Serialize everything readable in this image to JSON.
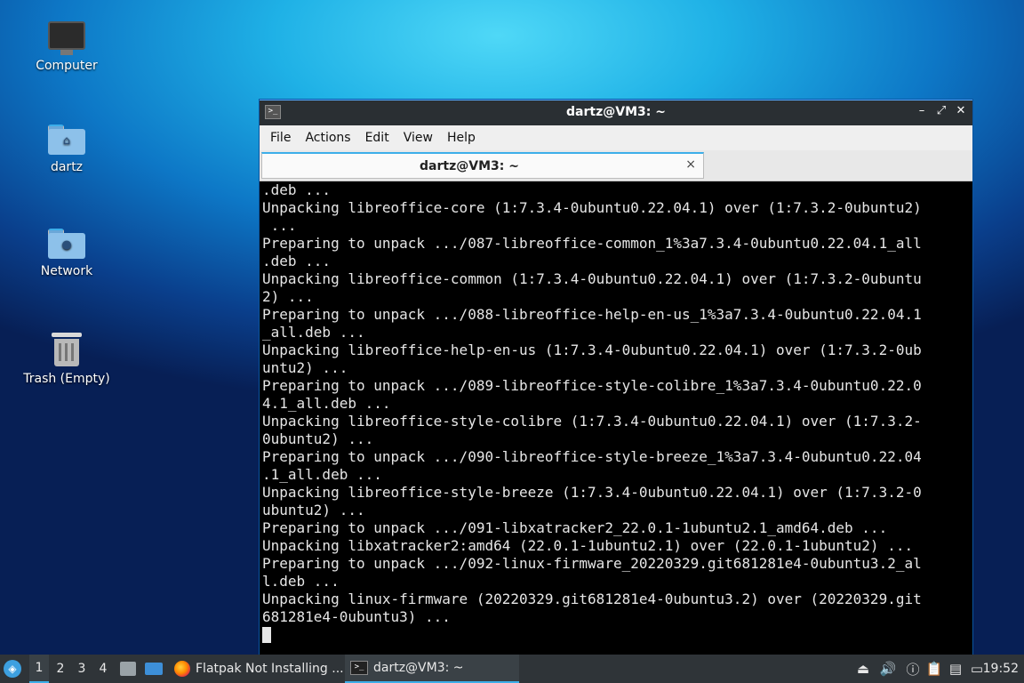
{
  "desktop": {
    "icons": [
      {
        "label": "Computer"
      },
      {
        "label": "dartz"
      },
      {
        "label": "Network"
      },
      {
        "label": "Trash (Empty)"
      }
    ]
  },
  "window": {
    "title": "dartz@VM3: ~",
    "menu": [
      "File",
      "Actions",
      "Edit",
      "View",
      "Help"
    ],
    "tab_label": "dartz@VM3: ~",
    "tab_close": "×",
    "buttons": {
      "minimize": "–",
      "maximize": "⤢",
      "close": "✕"
    }
  },
  "terminal": {
    "lines": [
      ".deb ...",
      "Unpacking libreoffice-core (1:7.3.4-0ubuntu0.22.04.1) over (1:7.3.2-0ubuntu2)",
      " ...",
      "Preparing to unpack .../087-libreoffice-common_1%3a7.3.4-0ubuntu0.22.04.1_all",
      ".deb ...",
      "Unpacking libreoffice-common (1:7.3.4-0ubuntu0.22.04.1) over (1:7.3.2-0ubuntu",
      "2) ...",
      "Preparing to unpack .../088-libreoffice-help-en-us_1%3a7.3.4-0ubuntu0.22.04.1",
      "_all.deb ...",
      "Unpacking libreoffice-help-en-us (1:7.3.4-0ubuntu0.22.04.1) over (1:7.3.2-0ub",
      "untu2) ...",
      "Preparing to unpack .../089-libreoffice-style-colibre_1%3a7.3.4-0ubuntu0.22.0",
      "4.1_all.deb ...",
      "Unpacking libreoffice-style-colibre (1:7.3.4-0ubuntu0.22.04.1) over (1:7.3.2-",
      "0ubuntu2) ...",
      "Preparing to unpack .../090-libreoffice-style-breeze_1%3a7.3.4-0ubuntu0.22.04",
      ".1_all.deb ...",
      "Unpacking libreoffice-style-breeze (1:7.3.4-0ubuntu0.22.04.1) over (1:7.3.2-0",
      "ubuntu2) ...",
      "Preparing to unpack .../091-libxatracker2_22.0.1-1ubuntu2.1_amd64.deb ...",
      "Unpacking libxatracker2:amd64 (22.0.1-1ubuntu2.1) over (22.0.1-1ubuntu2) ...",
      "Preparing to unpack .../092-linux-firmware_20220329.git681281e4-0ubuntu3.2_al",
      "l.deb ...",
      "Unpacking linux-firmware (20220329.git681281e4-0ubuntu3.2) over (20220329.git",
      "681281e4-0ubuntu3) ..."
    ]
  },
  "taskbar": {
    "workspaces": [
      "1",
      "2",
      "3",
      "4"
    ],
    "tasks": [
      {
        "label": "Flatpak Not Installing ...",
        "icon": "firefox-icon"
      },
      {
        "label": "dartz@VM3: ~",
        "icon": "terminal-icon"
      }
    ],
    "clock": "19:52"
  }
}
